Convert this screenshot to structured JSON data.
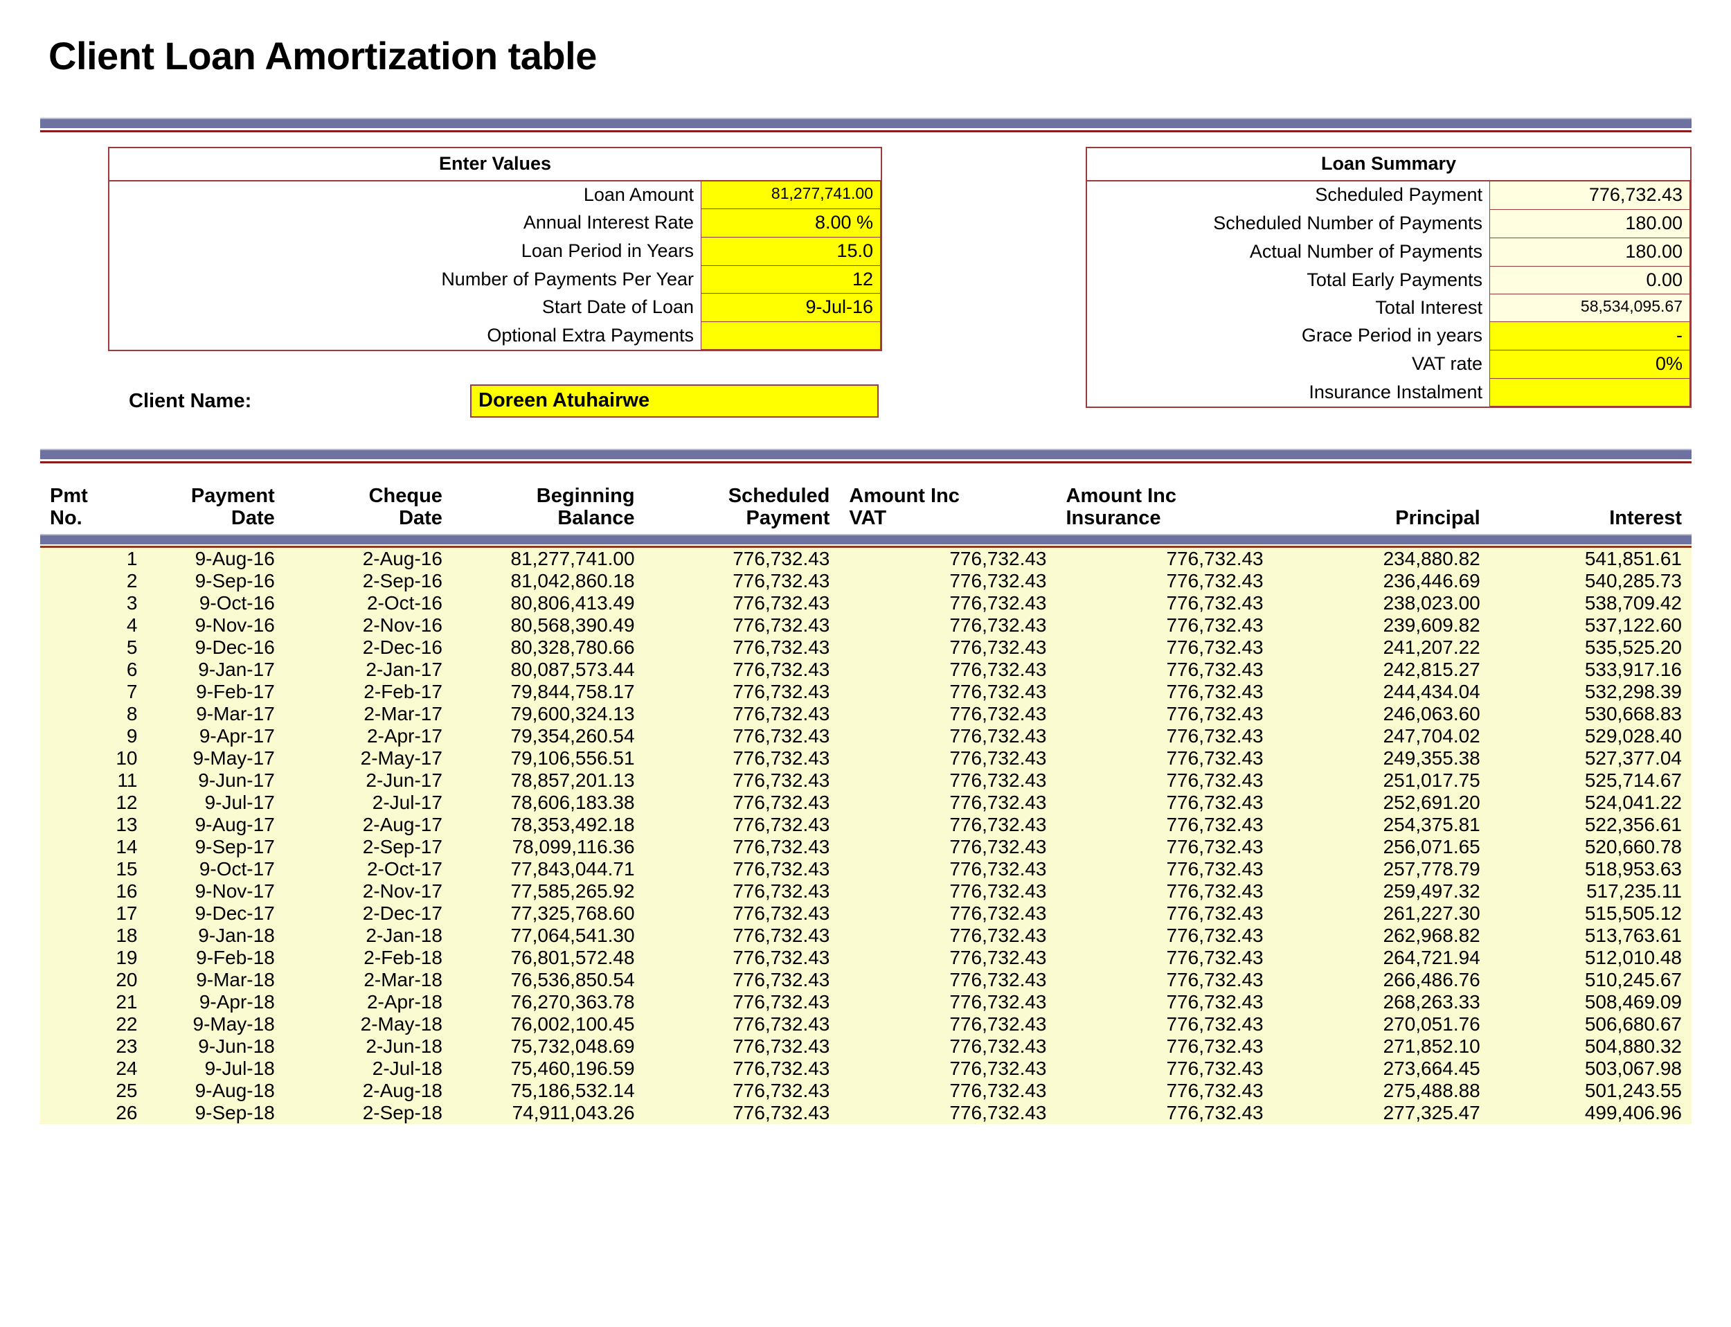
{
  "page_title": "Client Loan Amortization table",
  "enter_values": {
    "title": "Enter Values",
    "rows": [
      {
        "label": "Loan Amount",
        "value": "81,277,741.00",
        "style": "yellow small"
      },
      {
        "label": "Annual Interest Rate",
        "value": "8.00  %",
        "style": "yellow"
      },
      {
        "label": "Loan Period in Years",
        "value": "15.0",
        "style": "yellow"
      },
      {
        "label": "Number of Payments Per Year",
        "value": "12",
        "style": "yellow"
      },
      {
        "label": "Start Date of Loan",
        "value": "9-Jul-16",
        "style": "yellow"
      },
      {
        "label": "Optional Extra Payments",
        "value": "",
        "style": "yellow"
      }
    ]
  },
  "loan_summary": {
    "title": "Loan Summary",
    "rows": [
      {
        "label": "Scheduled Payment",
        "value": "776,732.43",
        "style": "cream"
      },
      {
        "label": "Scheduled Number of Payments",
        "value": "180.00",
        "style": "cream"
      },
      {
        "label": "Actual Number of Payments",
        "value": "180.00",
        "style": "cream"
      },
      {
        "label": "Total Early Payments",
        "value": "0.00",
        "style": "cream"
      },
      {
        "label": "Total Interest",
        "value": "58,534,095.67",
        "style": "cream small"
      },
      {
        "label": "Grace Period in years",
        "value": "-",
        "style": "yellow"
      },
      {
        "label": "VAT rate",
        "value": "0%",
        "style": "yellow"
      },
      {
        "label": "Insurance Instalment",
        "value": "",
        "style": "yellow"
      }
    ]
  },
  "client": {
    "label": "Client Name:",
    "name": "Doreen Atuhairwe"
  },
  "table": {
    "headers": [
      "Pmt\nNo.",
      "Payment\nDate",
      "Cheque\nDate",
      "Beginning\nBalance",
      "Scheduled\nPayment",
      "Amount Inc\nVAT",
      "Amount Inc\nInsurance",
      "Principal",
      "Interest"
    ],
    "rows": [
      [
        "1",
        "9-Aug-16",
        "2-Aug-16",
        "81,277,741.00",
        "776,732.43",
        "776,732.43",
        "776,732.43",
        "234,880.82",
        "541,851.61"
      ],
      [
        "2",
        "9-Sep-16",
        "2-Sep-16",
        "81,042,860.18",
        "776,732.43",
        "776,732.43",
        "776,732.43",
        "236,446.69",
        "540,285.73"
      ],
      [
        "3",
        "9-Oct-16",
        "2-Oct-16",
        "80,806,413.49",
        "776,732.43",
        "776,732.43",
        "776,732.43",
        "238,023.00",
        "538,709.42"
      ],
      [
        "4",
        "9-Nov-16",
        "2-Nov-16",
        "80,568,390.49",
        "776,732.43",
        "776,732.43",
        "776,732.43",
        "239,609.82",
        "537,122.60"
      ],
      [
        "5",
        "9-Dec-16",
        "2-Dec-16",
        "80,328,780.66",
        "776,732.43",
        "776,732.43",
        "776,732.43",
        "241,207.22",
        "535,525.20"
      ],
      [
        "6",
        "9-Jan-17",
        "2-Jan-17",
        "80,087,573.44",
        "776,732.43",
        "776,732.43",
        "776,732.43",
        "242,815.27",
        "533,917.16"
      ],
      [
        "7",
        "9-Feb-17",
        "2-Feb-17",
        "79,844,758.17",
        "776,732.43",
        "776,732.43",
        "776,732.43",
        "244,434.04",
        "532,298.39"
      ],
      [
        "8",
        "9-Mar-17",
        "2-Mar-17",
        "79,600,324.13",
        "776,732.43",
        "776,732.43",
        "776,732.43",
        "246,063.60",
        "530,668.83"
      ],
      [
        "9",
        "9-Apr-17",
        "2-Apr-17",
        "79,354,260.54",
        "776,732.43",
        "776,732.43",
        "776,732.43",
        "247,704.02",
        "529,028.40"
      ],
      [
        "10",
        "9-May-17",
        "2-May-17",
        "79,106,556.51",
        "776,732.43",
        "776,732.43",
        "776,732.43",
        "249,355.38",
        "527,377.04"
      ],
      [
        "11",
        "9-Jun-17",
        "2-Jun-17",
        "78,857,201.13",
        "776,732.43",
        "776,732.43",
        "776,732.43",
        "251,017.75",
        "525,714.67"
      ],
      [
        "12",
        "9-Jul-17",
        "2-Jul-17",
        "78,606,183.38",
        "776,732.43",
        "776,732.43",
        "776,732.43",
        "252,691.20",
        "524,041.22"
      ],
      [
        "13",
        "9-Aug-17",
        "2-Aug-17",
        "78,353,492.18",
        "776,732.43",
        "776,732.43",
        "776,732.43",
        "254,375.81",
        "522,356.61"
      ],
      [
        "14",
        "9-Sep-17",
        "2-Sep-17",
        "78,099,116.36",
        "776,732.43",
        "776,732.43",
        "776,732.43",
        "256,071.65",
        "520,660.78"
      ],
      [
        "15",
        "9-Oct-17",
        "2-Oct-17",
        "77,843,044.71",
        "776,732.43",
        "776,732.43",
        "776,732.43",
        "257,778.79",
        "518,953.63"
      ],
      [
        "16",
        "9-Nov-17",
        "2-Nov-17",
        "77,585,265.92",
        "776,732.43",
        "776,732.43",
        "776,732.43",
        "259,497.32",
        "517,235.11"
      ],
      [
        "17",
        "9-Dec-17",
        "2-Dec-17",
        "77,325,768.60",
        "776,732.43",
        "776,732.43",
        "776,732.43",
        "261,227.30",
        "515,505.12"
      ],
      [
        "18",
        "9-Jan-18",
        "2-Jan-18",
        "77,064,541.30",
        "776,732.43",
        "776,732.43",
        "776,732.43",
        "262,968.82",
        "513,763.61"
      ],
      [
        "19",
        "9-Feb-18",
        "2-Feb-18",
        "76,801,572.48",
        "776,732.43",
        "776,732.43",
        "776,732.43",
        "264,721.94",
        "512,010.48"
      ],
      [
        "20",
        "9-Mar-18",
        "2-Mar-18",
        "76,536,850.54",
        "776,732.43",
        "776,732.43",
        "776,732.43",
        "266,486.76",
        "510,245.67"
      ],
      [
        "21",
        "9-Apr-18",
        "2-Apr-18",
        "76,270,363.78",
        "776,732.43",
        "776,732.43",
        "776,732.43",
        "268,263.33",
        "508,469.09"
      ],
      [
        "22",
        "9-May-18",
        "2-May-18",
        "76,002,100.45",
        "776,732.43",
        "776,732.43",
        "776,732.43",
        "270,051.76",
        "506,680.67"
      ],
      [
        "23",
        "9-Jun-18",
        "2-Jun-18",
        "75,732,048.69",
        "776,732.43",
        "776,732.43",
        "776,732.43",
        "271,852.10",
        "504,880.32"
      ],
      [
        "24",
        "9-Jul-18",
        "2-Jul-18",
        "75,460,196.59",
        "776,732.43",
        "776,732.43",
        "776,732.43",
        "273,664.45",
        "503,067.98"
      ],
      [
        "25",
        "9-Aug-18",
        "2-Aug-18",
        "75,186,532.14",
        "776,732.43",
        "776,732.43",
        "776,732.43",
        "275,488.88",
        "501,243.55"
      ],
      [
        "26",
        "9-Sep-18",
        "2-Sep-18",
        "74,911,043.26",
        "776,732.43",
        "776,732.43",
        "776,732.43",
        "277,325.47",
        "499,406.96"
      ]
    ]
  },
  "colors": {
    "input_cell": "#ffff00",
    "computed_cell": "#fffee0",
    "data_row": "#fbfbd2",
    "panel_border": "#9c3b3b",
    "rule_bar": "#6e72a0",
    "rule_thin": "#8b1a1a"
  }
}
